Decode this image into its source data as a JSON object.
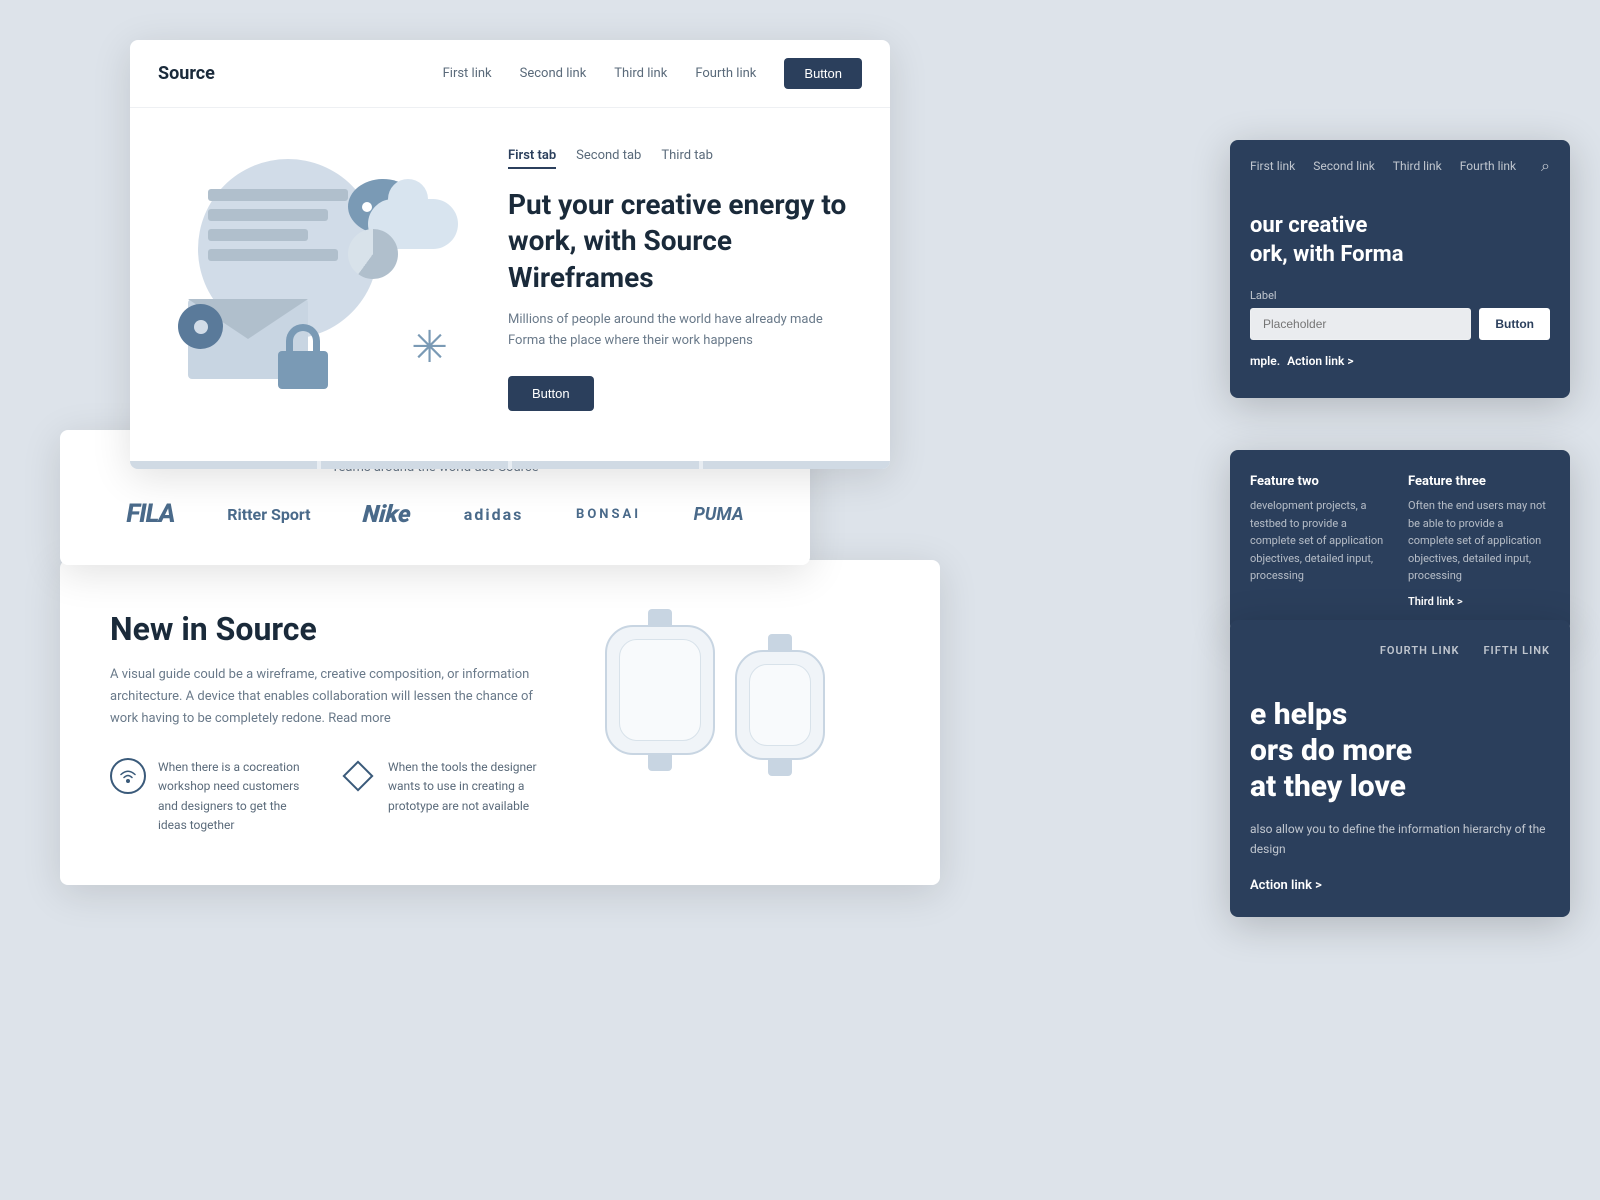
{
  "page": {
    "bg_color": "#dde3ea"
  },
  "card_main": {
    "nav": {
      "logo": "Source",
      "links": [
        "First link",
        "Second link",
        "Third link",
        "Fourth link"
      ],
      "button": "Button"
    },
    "tabs": [
      "First tab",
      "Second tab",
      "Third tab"
    ],
    "hero": {
      "title": "Put your creative energy to work, with Source Wireframes",
      "description": "Millions of people around the world have already made Forma the place where their work happens",
      "cta": "Button"
    }
  },
  "card_brands": {
    "title": "Teams around the world use Source",
    "brands": [
      "FILA",
      "Ritter Sport",
      "Nike",
      "adidas",
      "BONSAI",
      "PUMA"
    ]
  },
  "card_new": {
    "title": "New in Source",
    "description": "A visual guide could be a wireframe, creative composition, or information architecture. A device that enables collaboration will lessen the chance of work having to be completely redone. Read more",
    "features": [
      {
        "text": "When there is a cocreation workshop need customers and designers to get the ideas together"
      },
      {
        "text": "When the tools the designer wants to use in creating a prototype are not available"
      }
    ]
  },
  "card_dark_top": {
    "nav": {
      "links": [
        "First link",
        "Second link",
        "Third link",
        "Fourth link"
      ]
    },
    "hero": {
      "title_line1": "our creative",
      "title_line2": "ork, with Forma",
      "label": "Label",
      "input_placeholder": "Placeholder",
      "button": "Button",
      "action_prefix": "mple.",
      "action_link": "Action link",
      "action_suffix": ">"
    }
  },
  "card_dark_features": {
    "feature_two": {
      "title": "Feature two",
      "description": "development projects, a testbed to provide a complete set of application objectives, detailed input, processing"
    },
    "feature_three": {
      "title": "Feature three",
      "description": "Often the end users may not be able to provide a complete set of application objectives, detailed input, processing",
      "link": "Third link >"
    }
  },
  "card_dark_bottom": {
    "links": [
      "FOURTH LINK",
      "FIFTH LINK"
    ],
    "title_line1": "e helps",
    "title_line2": "ors do more",
    "title_line3": "at they love",
    "description": "also allow you to define the information hierarchy of the design",
    "action_link": "Action link >"
  }
}
